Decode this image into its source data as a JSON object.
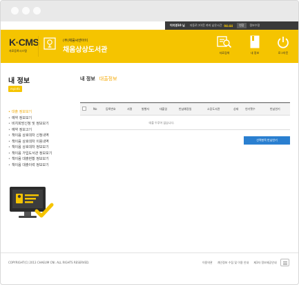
{
  "topbar": {
    "user": "이지영10 님",
    "auto_logout_label": "자동로그아웃 까지 남은시간",
    "timer": "04:44",
    "extend_label": "연장",
    "info_label": "정보수정"
  },
  "header": {
    "logo": "K·CMS",
    "logo_sub": "자료등록시스템",
    "library_sub": "(주)채움씨엔아이",
    "library_name": "채움상상도서관",
    "buttons": [
      {
        "label": "자료검색",
        "icon": "search-catalog-icon"
      },
      {
        "label": "내 정보",
        "icon": "my-info-book-icon"
      },
      {
        "label": "로그아웃",
        "icon": "power-icon"
      }
    ]
  },
  "sidebar": {
    "title": "내 정보",
    "badge": "myinfo",
    "items": [
      "대출 정보보기",
      "예약 정보보기",
      "비치희망신청 및 정보보기",
      "예약 정보고기",
      "책이음 상호대차 신청내역",
      "책이음 상호대차 이용내역",
      "책이음 상호대차 정보보기",
      "책이음 가입도서관 정보보기",
      "책이음 대출현황 정보보기",
      "책이음 대출이력 정보보기"
    ]
  },
  "main": {
    "breadcrumb_main": "내 정보",
    "breadcrumb_sub": "대출정보",
    "columns": [
      "No",
      "등록번호",
      "서명",
      "발행자",
      "대출일",
      "반납예정일",
      "소장도서관",
      "상태",
      "연기횟수",
      "반납연기"
    ],
    "empty_message": "대출 두루어 없습니다.",
    "renew_button": "선택항목 반납연기"
  },
  "footer": {
    "copyright": "COPYRIGHT(C) 2013 CHAEUM CNI. ALL RIGHTS RESERVED.",
    "links": [
      "이용약관",
      "개인정보 수집 및 이용 안내",
      "제3자 정보제공안내"
    ]
  },
  "colors": {
    "brand_yellow": "#f5c400",
    "accent_orange": "#f5a800",
    "button_blue": "#2a7fd0",
    "topbar_dark": "#3a3a3a"
  }
}
